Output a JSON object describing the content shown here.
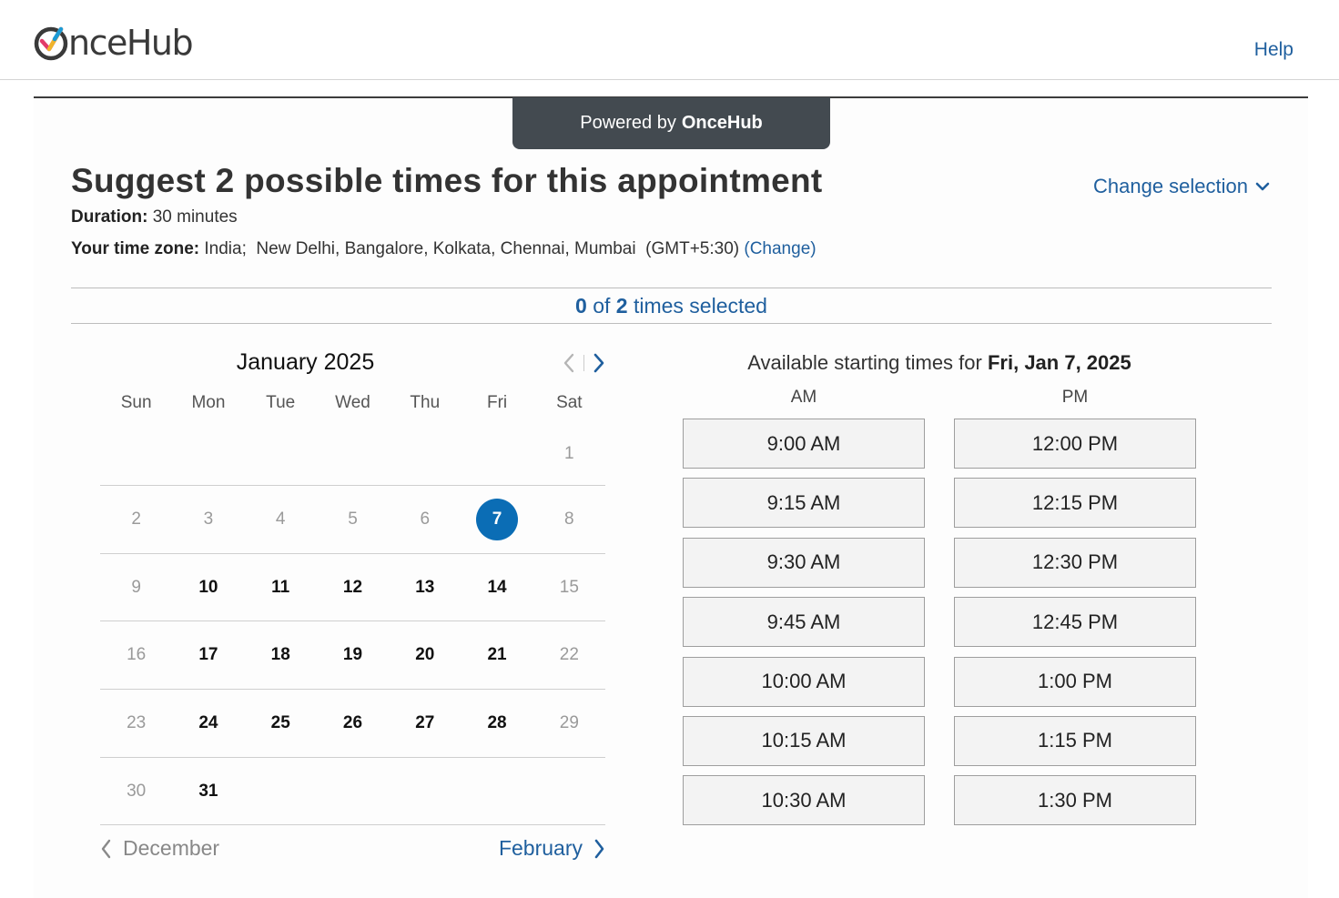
{
  "header": {
    "logo_text": "nceHub",
    "help_label": "Help"
  },
  "card": {
    "powered_prefix": "Powered by",
    "powered_brand": "OnceHub",
    "title": "Suggest 2 possible times for this appointment",
    "change_selection_label": "Change selection",
    "duration_label": "Duration:",
    "duration_value": "30 minutes",
    "timezone_label": "Your time zone:",
    "timezone_value": "India;  New Delhi, Bangalore, Kolkata, Chennai, Mumbai  (GMT+5:30)",
    "timezone_change_open": "(",
    "timezone_change_link": "Change",
    "timezone_change_close": ")"
  },
  "selection": {
    "selected_count": "0",
    "of_text": "of",
    "total_count": "2",
    "suffix": "times selected"
  },
  "calendar": {
    "month_label": "January 2025",
    "weekdays": [
      "Sun",
      "Mon",
      "Tue",
      "Wed",
      "Thu",
      "Fri",
      "Sat"
    ],
    "weeks": [
      [
        "",
        "",
        "",
        "",
        "",
        "",
        "1"
      ],
      [
        "2",
        "3",
        "4",
        "5",
        "6",
        "7",
        "8"
      ],
      [
        "9",
        "10",
        "11",
        "12",
        "13",
        "14",
        "15"
      ],
      [
        "16",
        "17",
        "18",
        "19",
        "20",
        "21",
        "22"
      ],
      [
        "23",
        "24",
        "25",
        "26",
        "27",
        "28",
        "29"
      ],
      [
        "30",
        "31",
        "",
        "",
        "",
        "",
        ""
      ]
    ],
    "selected_day": "7",
    "prev_month_label": "December",
    "next_month_label": "February"
  },
  "times": {
    "heading_prefix": "Available starting times for",
    "heading_date": "Fri, Jan 7, 2025",
    "am_label": "AM",
    "pm_label": "PM",
    "am_slots": [
      "9:00 AM",
      "9:15 AM",
      "9:30 AM",
      "9:45 AM",
      "10:00 AM",
      "10:15 AM",
      "10:30 AM"
    ],
    "pm_slots": [
      "12:00 PM",
      "12:15 PM",
      "12:30 PM",
      "12:45 PM",
      "1:00 PM",
      "1:15 PM",
      "1:30 PM"
    ]
  },
  "colors": {
    "accent": "#1f5f9e",
    "selected_day": "#0b6db5",
    "powered_bg": "#434a50"
  }
}
